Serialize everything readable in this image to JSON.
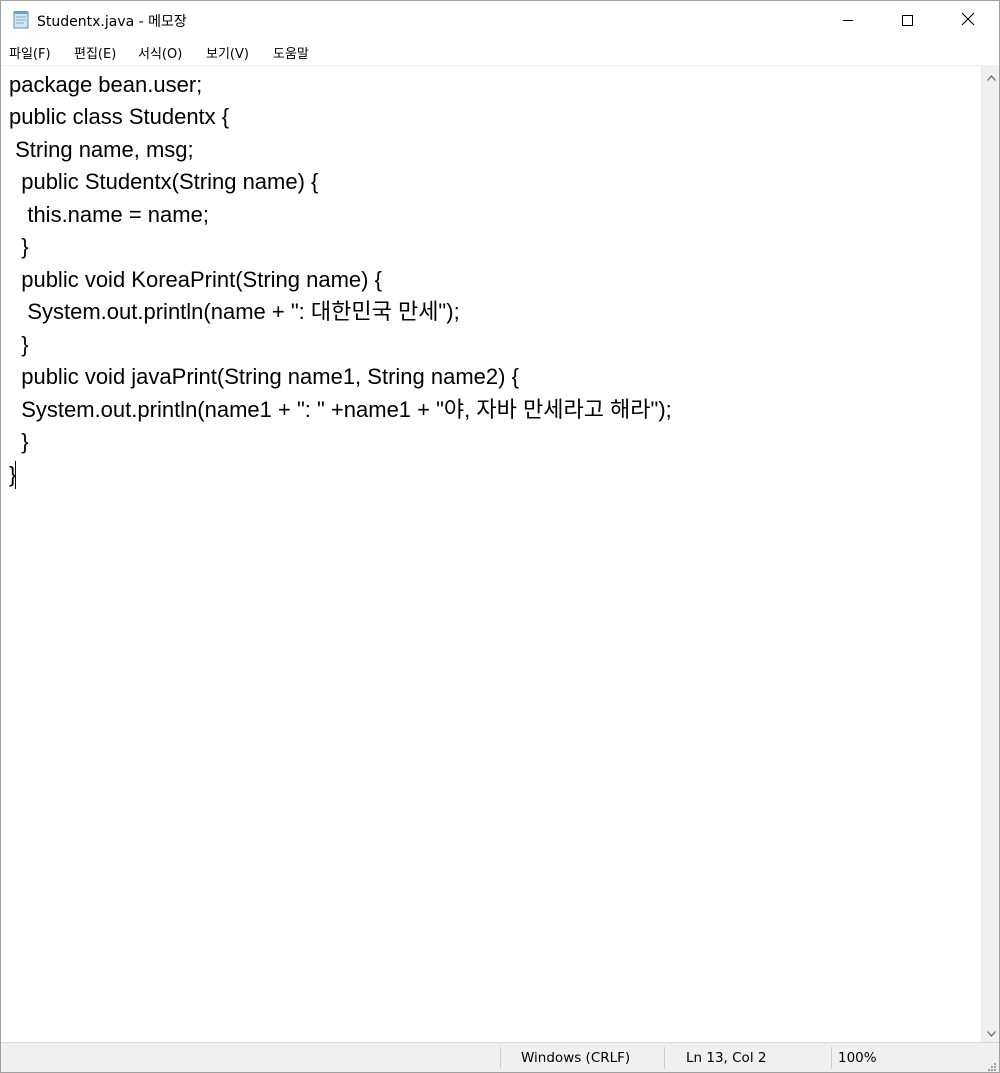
{
  "window": {
    "title": "Studentx.java - 메모장"
  },
  "menu": {
    "items": [
      {
        "label": "파일(F)"
      },
      {
        "label": "편집(E)"
      },
      {
        "label": "서식(O)"
      },
      {
        "label": "보기(V)"
      },
      {
        "label": "도움말"
      }
    ]
  },
  "editor": {
    "lines": [
      "package bean.user;",
      "public class Studentx {",
      " String name, msg;",
      "  public Studentx(String name) {",
      "   this.name = name;",
      "  }",
      "  public void KoreaPrint(String name) {",
      "   System.out.println(name + \": 대한민국 만세\");",
      "  }",
      "  public void javaPrint(String name1, String name2) {",
      "  System.out.println(name1 + \": \" +name1 + \"야, 자바 만세라고 해라\");",
      "  }",
      "}"
    ]
  },
  "status": {
    "line_ending": "Windows (CRLF)",
    "position": "Ln 13, Col 2",
    "zoom": "100%"
  },
  "icons": {
    "app": "notepad-icon",
    "minimize": "minimize-icon",
    "maximize": "maximize-icon",
    "close": "close-icon",
    "scroll_up": "chevron-up-icon",
    "scroll_down": "chevron-down-icon",
    "resize": "resize-grip-icon"
  }
}
